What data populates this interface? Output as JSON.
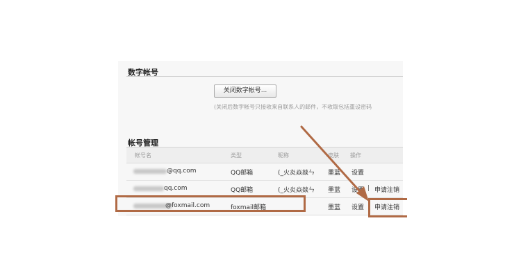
{
  "digital_account": {
    "title": "数字帐号",
    "close_button_label": "关闭数字帐号...",
    "note": "(关闭后数字帐号只接收来自联系人的邮件，不收取包括重设密码"
  },
  "account_management": {
    "title": "帐号管理",
    "columns": [
      "帐号名",
      "类型",
      "昵称",
      "皮肤",
      "操作"
    ],
    "rows": [
      {
        "account_suffix": "@qq.com",
        "type": "QQ邮箱",
        "nickname": "(_火炎焱燚ㄣ",
        "skin": "墨蓝",
        "action_settings": "设置",
        "action_cancel": ""
      },
      {
        "account_suffix": "qq.com",
        "type": "QQ邮箱",
        "nickname": "(_火炎焱燚ㄣ",
        "skin": "墨蓝",
        "action_settings": "设置",
        "action_cancel": "申请注销"
      },
      {
        "account_suffix": "@foxmail.com",
        "type": "foxmail邮箱",
        "nickname": "",
        "skin": "墨蓝",
        "action_settings": "设置",
        "action_cancel": "申请注销"
      }
    ]
  },
  "colors": {
    "annotation": "#b06a45",
    "panel_bg": "#f7f7f7",
    "header_bg": "#eeeeee"
  }
}
